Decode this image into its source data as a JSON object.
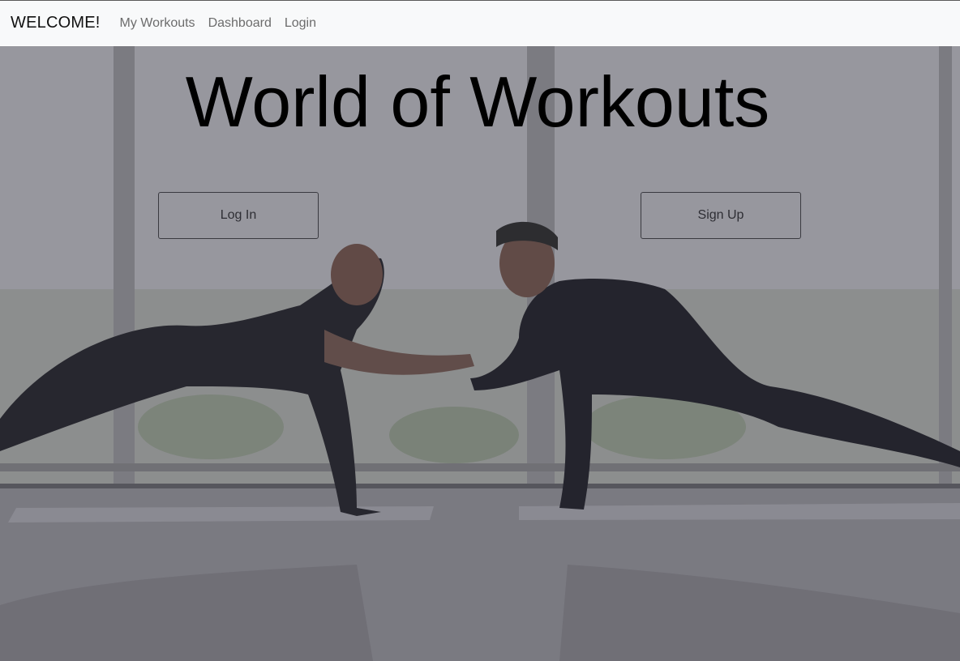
{
  "navbar": {
    "brand": "WELCOME!",
    "links": [
      "My Workouts",
      "Dashboard",
      "Login"
    ]
  },
  "hero": {
    "title": "World of Workouts",
    "login_button": "Log In",
    "signup_button": "Sign Up",
    "background_description": "Two people in plank position clasping hands in front of large windows"
  },
  "colors": {
    "navbar_bg": "#f8f9fa",
    "overlay": "#6e6e78",
    "title": "#000000",
    "button_border": "#3a3a40"
  }
}
